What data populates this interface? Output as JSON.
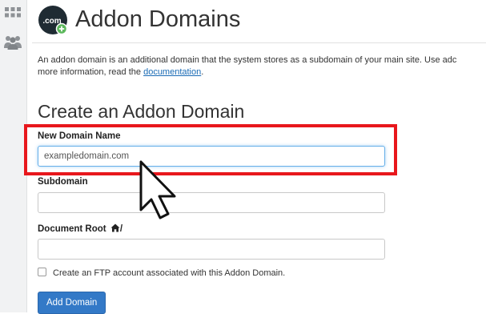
{
  "sidebar": {
    "items": [
      {
        "icon": "grid-icon"
      },
      {
        "icon": "users-icon"
      }
    ]
  },
  "header": {
    "icon": "domain-add-icon",
    "icon_text": ".com",
    "title": "Addon Domains"
  },
  "description": {
    "line1": "An addon domain is an additional domain that the system stores as a subdomain of your main site. Use adc",
    "line2_prefix": "more information, read the ",
    "link_text": "documentation",
    "line2_suffix": "."
  },
  "form": {
    "section_title": "Create an Addon Domain",
    "new_domain_label": "New Domain Name",
    "new_domain_value": "exampledomain.com",
    "subdomain_label": "Subdomain",
    "subdomain_value": "",
    "docroot_label_prefix": "Document Root ",
    "docroot_label_suffix": "/",
    "docroot_value": "",
    "ftp_checkbox_label": "Create an FTP account associated with this Addon Domain.",
    "ftp_checked": false,
    "submit_label": "Add Domain"
  },
  "colors": {
    "highlight": "#e8171c",
    "primary": "#3379c7",
    "link": "#1a6bb5"
  }
}
